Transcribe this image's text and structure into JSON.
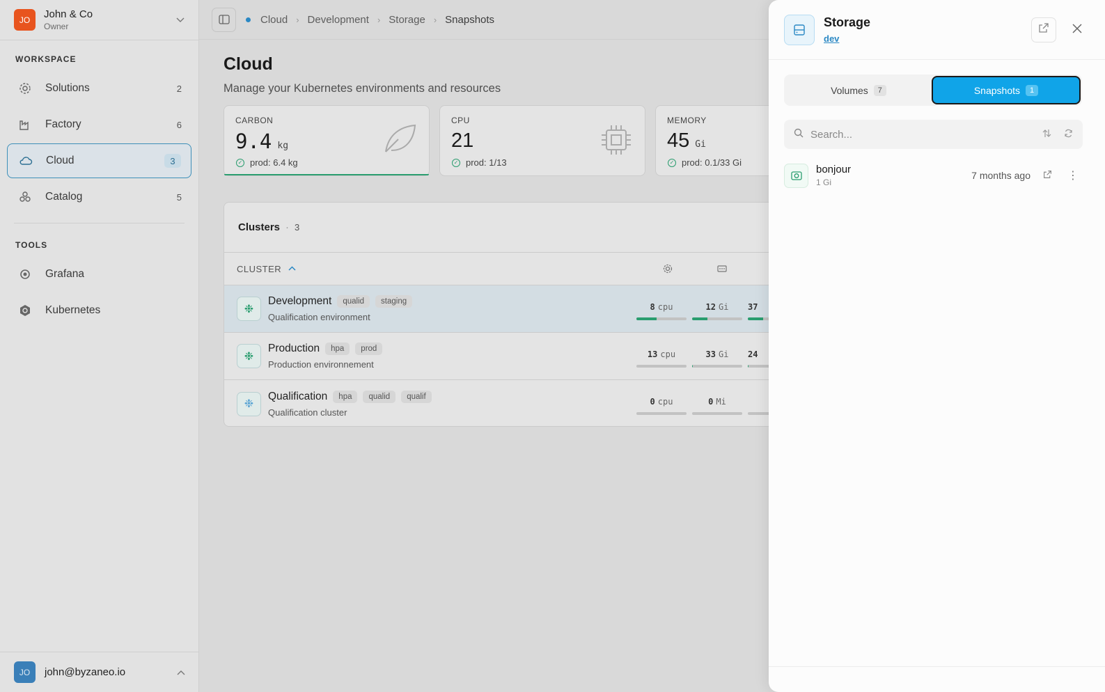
{
  "org": {
    "initials": "JO",
    "name": "John & Co",
    "role": "Owner"
  },
  "sidebar": {
    "workspace_label": "WORKSPACE",
    "items": [
      {
        "label": "Solutions",
        "count": "2",
        "icon": "gear-icon"
      },
      {
        "label": "Factory",
        "count": "6",
        "icon": "factory-icon"
      },
      {
        "label": "Cloud",
        "count": "3",
        "icon": "cloud-icon"
      },
      {
        "label": "Catalog",
        "count": "5",
        "icon": "catalog-icon"
      }
    ],
    "tools_label": "TOOLS",
    "tools": [
      {
        "label": "Grafana",
        "icon": "grafana-icon"
      },
      {
        "label": "Kubernetes",
        "icon": "kubernetes-icon"
      }
    ]
  },
  "user": {
    "initials": "JO",
    "email": "john@byzaneo.io"
  },
  "breadcrumb": [
    "Cloud",
    "Development",
    "Storage",
    "Snapshots"
  ],
  "page": {
    "title": "Cloud",
    "subtitle": "Manage your Kubernetes environments and resources"
  },
  "stats": [
    {
      "label": "CARBON",
      "value": "9.4",
      "unit": "kg",
      "foot": "prod: 6.4 kg"
    },
    {
      "label": "CPU",
      "value": "21",
      "unit": "",
      "foot": "prod: 1/13"
    },
    {
      "label": "MEMORY",
      "value": "45",
      "unit": "Gi",
      "foot": "prod: 0.1/33 Gi"
    }
  ],
  "clusters": {
    "title": "Clusters",
    "count": "3",
    "column": "CLUSTER",
    "rows": [
      {
        "name": "Development",
        "tags": [
          "qualid",
          "staging"
        ],
        "desc": "Qualification environment",
        "cpu": "8",
        "cpu_unit": "cpu",
        "mem": "12",
        "mem_unit": "Gi",
        "third": "37",
        "cpu_fill": 0.4,
        "mem_fill": 0.3,
        "third_fill": 0.3
      },
      {
        "name": "Production",
        "tags": [
          "hpa",
          "prod"
        ],
        "desc": "Production environnement",
        "cpu": "13",
        "cpu_unit": "cpu",
        "mem": "33",
        "mem_unit": "Gi",
        "third": "24",
        "cpu_fill": 0,
        "mem_fill": 0.02,
        "third_fill": 0.02
      },
      {
        "name": "Qualification",
        "tags": [
          "hpa",
          "qualid",
          "qualif"
        ],
        "desc": "Qualification cluster",
        "cpu": "0",
        "cpu_unit": "cpu",
        "mem": "0",
        "mem_unit": "Mi",
        "third": "",
        "cpu_fill": 0,
        "mem_fill": 0,
        "third_fill": 0
      }
    ]
  },
  "panel": {
    "title": "Storage",
    "env": "dev",
    "tabs": [
      {
        "label": "Volumes",
        "count": "7"
      },
      {
        "label": "Snapshots",
        "count": "1"
      }
    ],
    "search_placeholder": "Search...",
    "snapshots": [
      {
        "name": "bonjour",
        "size": "1 Gi",
        "time": "7 months ago"
      }
    ]
  },
  "colors": {
    "accent": "#10a4e8",
    "brand_org": "#e8541e",
    "success": "#2a9d6f",
    "link": "#2a88c4"
  }
}
